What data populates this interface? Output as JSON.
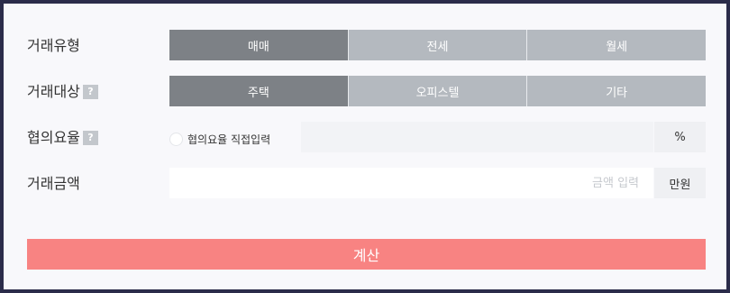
{
  "form": {
    "trade_type": {
      "label": "거래유형",
      "options": [
        "매매",
        "전세",
        "월세"
      ],
      "selected": "매매"
    },
    "property_type": {
      "label": "거래대상",
      "help_icon": "question-mark",
      "options": [
        "주택",
        "오피스텔",
        "기타"
      ],
      "selected": "주택"
    },
    "rate": {
      "label": "협의요율",
      "help_icon": "question-mark",
      "radio_label": "협의요율 직접입력",
      "value": "",
      "unit": "%"
    },
    "amount": {
      "label": "거래금액",
      "placeholder": "금액 입력",
      "value": "",
      "unit": "만원"
    },
    "submit_label": "계산"
  },
  "colors": {
    "page_border": "#2b2c4a",
    "card_background": "#f8f8fb",
    "segment_active": "#7d8186",
    "segment_inactive": "#b4b9bf",
    "submit_button": "#f88382"
  }
}
